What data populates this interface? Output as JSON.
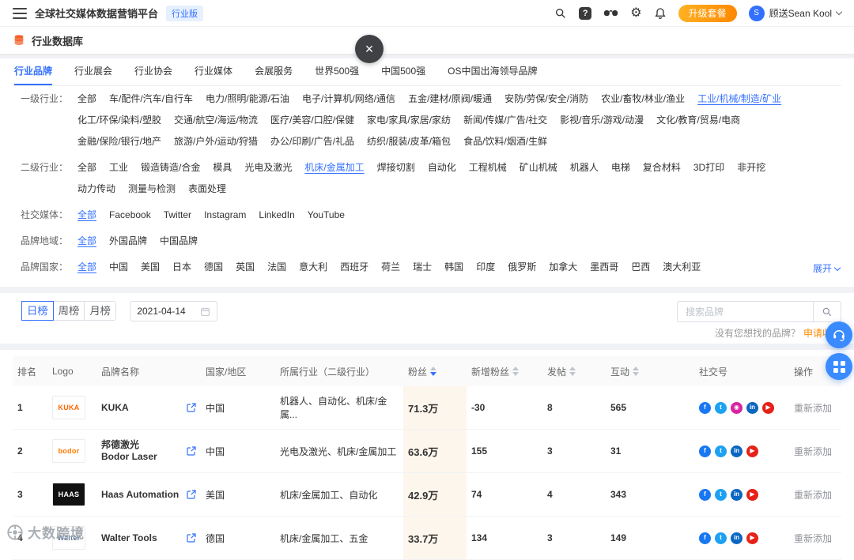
{
  "icons": {
    "help_glyph": "?",
    "gear_glyph": "⚙",
    "close_glyph": "×",
    "avatar_text": "S"
  },
  "topbar": {
    "title": "全球社交媒体数据营销平台",
    "badge": "行业版",
    "upgrade_label": "升级套餐",
    "user_name": "顾送Sean Kool"
  },
  "page_header": {
    "title": "行业数据库"
  },
  "tabs": [
    {
      "label": "行业品牌",
      "active": true
    },
    {
      "label": "行业展会"
    },
    {
      "label": "行业协会"
    },
    {
      "label": "行业媒体"
    },
    {
      "label": "会展服务"
    },
    {
      "label": "世界500强"
    },
    {
      "label": "中国500强"
    },
    {
      "label": "OS中国出海领导品牌"
    }
  ],
  "filters": [
    {
      "label": "一级行业：",
      "options": [
        {
          "label": "全部"
        },
        {
          "label": "车/配件/汽车/自行车"
        },
        {
          "label": "电力/照明/能源/石油"
        },
        {
          "label": "电子/计算机/网络/通信"
        },
        {
          "label": "五金/建材/原阀/暖通"
        },
        {
          "label": "安防/劳保/安全/消防"
        },
        {
          "label": "农业/畜牧/林业/渔业"
        },
        {
          "label": "工业/机械/制造/矿业",
          "active": true
        },
        {
          "label": "化工/环保/染料/塑胶"
        },
        {
          "label": "交通/航空/海运/物流"
        },
        {
          "label": "医疗/美容/口腔/保健"
        },
        {
          "label": "家电/家具/家居/家纺"
        },
        {
          "label": "新闻/传媒/广告/社交"
        },
        {
          "label": "影视/音乐/游戏/动漫"
        },
        {
          "label": "文化/教育/贸易/电商"
        },
        {
          "label": "金融/保险/银行/地产"
        },
        {
          "label": "旅游/户外/运动/狩猎"
        },
        {
          "label": "办公/印刷/广告/礼品"
        },
        {
          "label": "纺织/服装/皮革/箱包"
        },
        {
          "label": "食品/饮料/烟酒/生鲜"
        }
      ]
    },
    {
      "label": "二级行业：",
      "options": [
        {
          "label": "全部"
        },
        {
          "label": "工业"
        },
        {
          "label": "锻造铸造/合金"
        },
        {
          "label": "模具"
        },
        {
          "label": "光电及激光"
        },
        {
          "label": "机床/金属加工",
          "active": true
        },
        {
          "label": "焊接切割"
        },
        {
          "label": "自动化"
        },
        {
          "label": "工程机械"
        },
        {
          "label": "矿山机械"
        },
        {
          "label": "机器人"
        },
        {
          "label": "电梯"
        },
        {
          "label": "复合材料"
        },
        {
          "label": "3D打印"
        },
        {
          "label": "非开挖"
        },
        {
          "label": "动力传动"
        },
        {
          "label": "测量与检测"
        },
        {
          "label": "表面处理"
        }
      ]
    },
    {
      "label": "社交媒体：",
      "options": [
        {
          "label": "全部",
          "active": true
        },
        {
          "label": "Facebook"
        },
        {
          "label": "Twitter"
        },
        {
          "label": "Instagram"
        },
        {
          "label": "LinkedIn"
        },
        {
          "label": "YouTube"
        }
      ]
    },
    {
      "label": "品牌地域：",
      "options": [
        {
          "label": "全部",
          "active": true
        },
        {
          "label": "外国品牌"
        },
        {
          "label": "中国品牌"
        }
      ]
    },
    {
      "label": "品牌国家：",
      "options": [
        {
          "label": "全部",
          "active": true
        },
        {
          "label": "中国"
        },
        {
          "label": "美国"
        },
        {
          "label": "日本"
        },
        {
          "label": "德国"
        },
        {
          "label": "英国"
        },
        {
          "label": "法国"
        },
        {
          "label": "意大利"
        },
        {
          "label": "西班牙"
        },
        {
          "label": "荷兰"
        },
        {
          "label": "瑞士"
        },
        {
          "label": "韩国"
        },
        {
          "label": "印度"
        },
        {
          "label": "俄罗斯"
        },
        {
          "label": "加拿大"
        },
        {
          "label": "墨西哥"
        },
        {
          "label": "巴西"
        },
        {
          "label": "澳大利亚"
        }
      ],
      "expand": "展开"
    }
  ],
  "toolbar": {
    "rank_tabs": [
      {
        "label": "日榜",
        "active": true
      },
      {
        "label": "周榜"
      },
      {
        "label": "月榜"
      }
    ],
    "date": "2021-04-14",
    "search_placeholder": "搜索品牌",
    "not_found_text": "没有您想找的品牌？",
    "apply_label": "申请收录"
  },
  "table": {
    "fans_sorted_desc": true,
    "headers": [
      "排名",
      "Logo",
      "品牌名称",
      "国家/地区",
      "所属行业（二级行业）",
      "粉丝",
      "新增粉丝",
      "发帖",
      "互动",
      "社交号",
      "操作"
    ],
    "rows": [
      {
        "rank": "1",
        "logo": {
          "text": "KUKA",
          "bg": "#ffffff",
          "color": "#ff6600"
        },
        "name": "KUKA",
        "name_sub": "",
        "country": "中国",
        "industry": "机器人、自动化、机床/金属...",
        "fans": "71.3万",
        "new_fans": "-30",
        "posts": "8",
        "interactions": "565",
        "socials": [
          {
            "name": "facebook-icon",
            "color": "#1877f2",
            "glyph": "f"
          },
          {
            "name": "twitter-icon",
            "color": "#1da1f2",
            "glyph": "t"
          },
          {
            "name": "instagram-icon",
            "color": "#d6249f",
            "glyph": "◉"
          },
          {
            "name": "linkedin-icon",
            "color": "#0a66c2",
            "glyph": "in"
          },
          {
            "name": "youtube-icon",
            "color": "#e62117",
            "glyph": "▶"
          }
        ],
        "action": "重新添加"
      },
      {
        "rank": "2",
        "logo": {
          "text": "bodor",
          "bg": "#ffffff",
          "color": "#ff7a00"
        },
        "name": "邦德激光",
        "name_sub": "Bodor Laser",
        "country": "中国",
        "industry": "光电及激光、机床/金属加工",
        "fans": "63.6万",
        "new_fans": "155",
        "posts": "3",
        "interactions": "31",
        "socials": [
          {
            "name": "facebook-icon",
            "color": "#1877f2",
            "glyph": "f"
          },
          {
            "name": "twitter-icon",
            "color": "#1da1f2",
            "glyph": "t"
          },
          {
            "name": "linkedin-icon",
            "color": "#0a66c2",
            "glyph": "in"
          },
          {
            "name": "youtube-icon",
            "color": "#e62117",
            "glyph": "▶"
          }
        ],
        "action": "重新添加"
      },
      {
        "rank": "3",
        "logo": {
          "text": "HAAS",
          "bg": "#111111",
          "color": "#ffffff"
        },
        "name": "Haas Automation",
        "name_sub": "",
        "country": "美国",
        "industry": "机床/金属加工、自动化",
        "fans": "42.9万",
        "new_fans": "74",
        "posts": "4",
        "interactions": "343",
        "socials": [
          {
            "name": "facebook-icon",
            "color": "#1877f2",
            "glyph": "f"
          },
          {
            "name": "twitter-icon",
            "color": "#1da1f2",
            "glyph": "t"
          },
          {
            "name": "linkedin-icon",
            "color": "#0a66c2",
            "glyph": "in"
          },
          {
            "name": "youtube-icon",
            "color": "#e62117",
            "glyph": "▶"
          }
        ],
        "action": "重新添加"
      },
      {
        "rank": "4",
        "logo": {
          "text": "Walter",
          "bg": "#ffffff",
          "color": "#5b7a9d"
        },
        "name": "Walter Tools",
        "name_sub": "",
        "country": "德国",
        "industry": "机床/金属加工、五金",
        "fans": "33.7万",
        "new_fans": "134",
        "posts": "3",
        "interactions": "149",
        "socials": [
          {
            "name": "facebook-icon",
            "color": "#1877f2",
            "glyph": "f"
          },
          {
            "name": "twitter-icon",
            "color": "#1da1f2",
            "glyph": "t"
          },
          {
            "name": "linkedin-icon",
            "color": "#0a66c2",
            "glyph": "in"
          },
          {
            "name": "youtube-icon",
            "color": "#e62117",
            "glyph": "▶"
          }
        ],
        "action": "重新添加"
      }
    ]
  },
  "watermark": {
    "text": "大数跨境"
  }
}
